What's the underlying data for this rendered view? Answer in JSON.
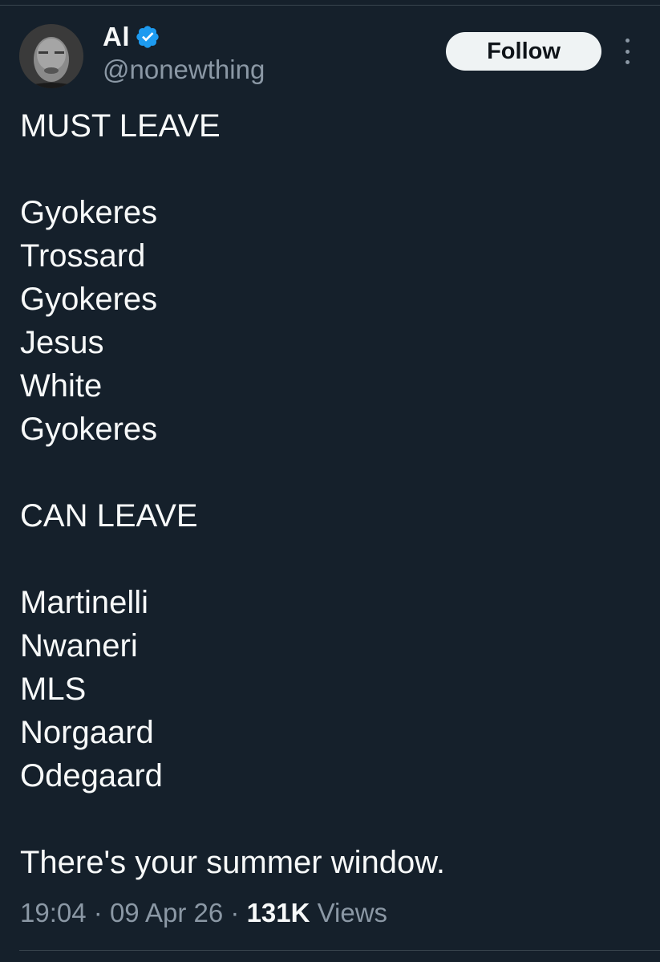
{
  "author": {
    "display_name": "Al",
    "handle": "@nonewthing",
    "verified": true
  },
  "follow_button": {
    "label": "Follow"
  },
  "tweet": {
    "must_leave_heading": "MUST LEAVE",
    "must_leave": [
      "Gyokeres",
      "Trossard",
      "Gyokeres",
      "Jesus",
      "White",
      "Gyokeres"
    ],
    "can_leave_heading": "CAN LEAVE",
    "can_leave": [
      "Martinelli",
      "Nwaneri",
      "MLS",
      "Norgaard",
      "Odegaard"
    ],
    "closing": "There's your summer window."
  },
  "meta": {
    "time": "19:04",
    "separator": "·",
    "date": "09 Apr 26",
    "views_count": "131K",
    "views_label": "Views"
  },
  "colors": {
    "background": "#15202b",
    "text": "#f7f9f9",
    "secondary": "#8b98a5",
    "verified": "#1d9bf0",
    "follow_bg": "#eff3f4"
  }
}
